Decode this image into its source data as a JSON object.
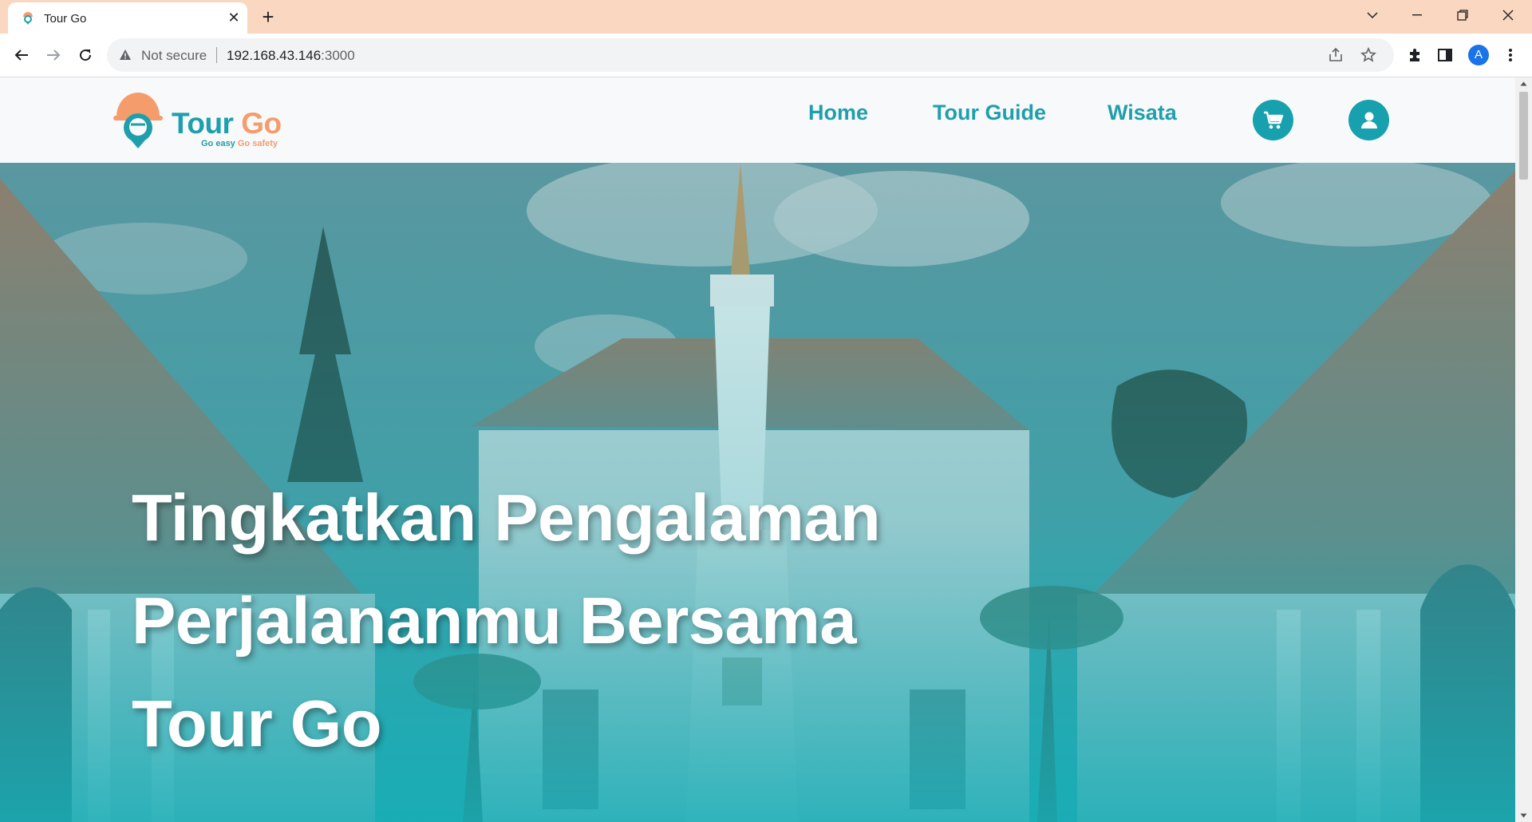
{
  "browser": {
    "tab_title": "Tour Go",
    "new_tab_icon": "plus-icon",
    "security_label": "Not secure",
    "url_host": "192.168.43.146",
    "url_port": ":3000",
    "profile_initial": "A"
  },
  "site": {
    "logo_word1": "Tour",
    "logo_word2": "Go",
    "tagline_part1": "Go easy",
    "tagline_part2": "Go safety",
    "nav": [
      {
        "label": "Home"
      },
      {
        "label": "Tour Guide"
      },
      {
        "label": "Wisata"
      }
    ],
    "cart_icon": "cart-icon",
    "user_icon": "user-icon"
  },
  "hero": {
    "line1": "Tingkatkan Pengalaman",
    "line2": "Perjalananmu Bersama",
    "line3": "Tour Go"
  },
  "colors": {
    "brand_teal": "#1f9fad",
    "brand_orange": "#f59c6d",
    "tabbar_bg": "#fad7c0"
  }
}
